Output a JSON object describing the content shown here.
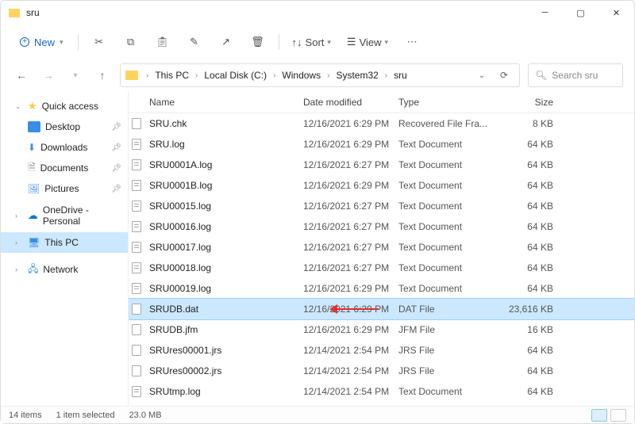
{
  "window": {
    "title": "sru"
  },
  "toolbar": {
    "new_label": "New",
    "sort_label": "Sort",
    "view_label": "View"
  },
  "breadcrumbs": [
    "This PC",
    "Local Disk (C:)",
    "Windows",
    "System32",
    "sru"
  ],
  "search": {
    "placeholder": "Search sru"
  },
  "sidebar": {
    "quick_access": "Quick access",
    "desktop": "Desktop",
    "downloads": "Downloads",
    "documents": "Documents",
    "pictures": "Pictures",
    "onedrive": "OneDrive - Personal",
    "thispc": "This PC",
    "network": "Network"
  },
  "columns": {
    "name": "Name",
    "date": "Date modified",
    "type": "Type",
    "size": "Size"
  },
  "files": [
    {
      "name": "SRU.chk",
      "date": "12/16/2021 6:29 PM",
      "type": "Recovered File Fra...",
      "size": "8 KB",
      "ico": "plain"
    },
    {
      "name": "SRU.log",
      "date": "12/16/2021 6:29 PM",
      "type": "Text Document",
      "size": "64 KB",
      "ico": "lines"
    },
    {
      "name": "SRU0001A.log",
      "date": "12/16/2021 6:27 PM",
      "type": "Text Document",
      "size": "64 KB",
      "ico": "lines"
    },
    {
      "name": "SRU0001B.log",
      "date": "12/16/2021 6:29 PM",
      "type": "Text Document",
      "size": "64 KB",
      "ico": "lines"
    },
    {
      "name": "SRU00015.log",
      "date": "12/16/2021 6:27 PM",
      "type": "Text Document",
      "size": "64 KB",
      "ico": "lines"
    },
    {
      "name": "SRU00016.log",
      "date": "12/16/2021 6:27 PM",
      "type": "Text Document",
      "size": "64 KB",
      "ico": "lines"
    },
    {
      "name": "SRU00017.log",
      "date": "12/16/2021 6:27 PM",
      "type": "Text Document",
      "size": "64 KB",
      "ico": "lines"
    },
    {
      "name": "SRU00018.log",
      "date": "12/16/2021 6:27 PM",
      "type": "Text Document",
      "size": "64 KB",
      "ico": "lines"
    },
    {
      "name": "SRU00019.log",
      "date": "12/16/2021 6:29 PM",
      "type": "Text Document",
      "size": "64 KB",
      "ico": "lines"
    },
    {
      "name": "SRUDB.dat",
      "date": "12/16/2021 6:29 PM",
      "type": "DAT File",
      "size": "23,616 KB",
      "ico": "plain",
      "selected": true
    },
    {
      "name": "SRUDB.jfm",
      "date": "12/16/2021 6:29 PM",
      "type": "JFM File",
      "size": "16 KB",
      "ico": "plain"
    },
    {
      "name": "SRUres00001.jrs",
      "date": "12/14/2021 2:54 PM",
      "type": "JRS File",
      "size": "64 KB",
      "ico": "plain"
    },
    {
      "name": "SRUres00002.jrs",
      "date": "12/14/2021 2:54 PM",
      "type": "JRS File",
      "size": "64 KB",
      "ico": "plain"
    },
    {
      "name": "SRUtmp.log",
      "date": "12/14/2021 2:54 PM",
      "type": "Text Document",
      "size": "64 KB",
      "ico": "lines"
    }
  ],
  "status": {
    "count": "14 items",
    "selection": "1 item selected",
    "size": "23.0 MB"
  }
}
